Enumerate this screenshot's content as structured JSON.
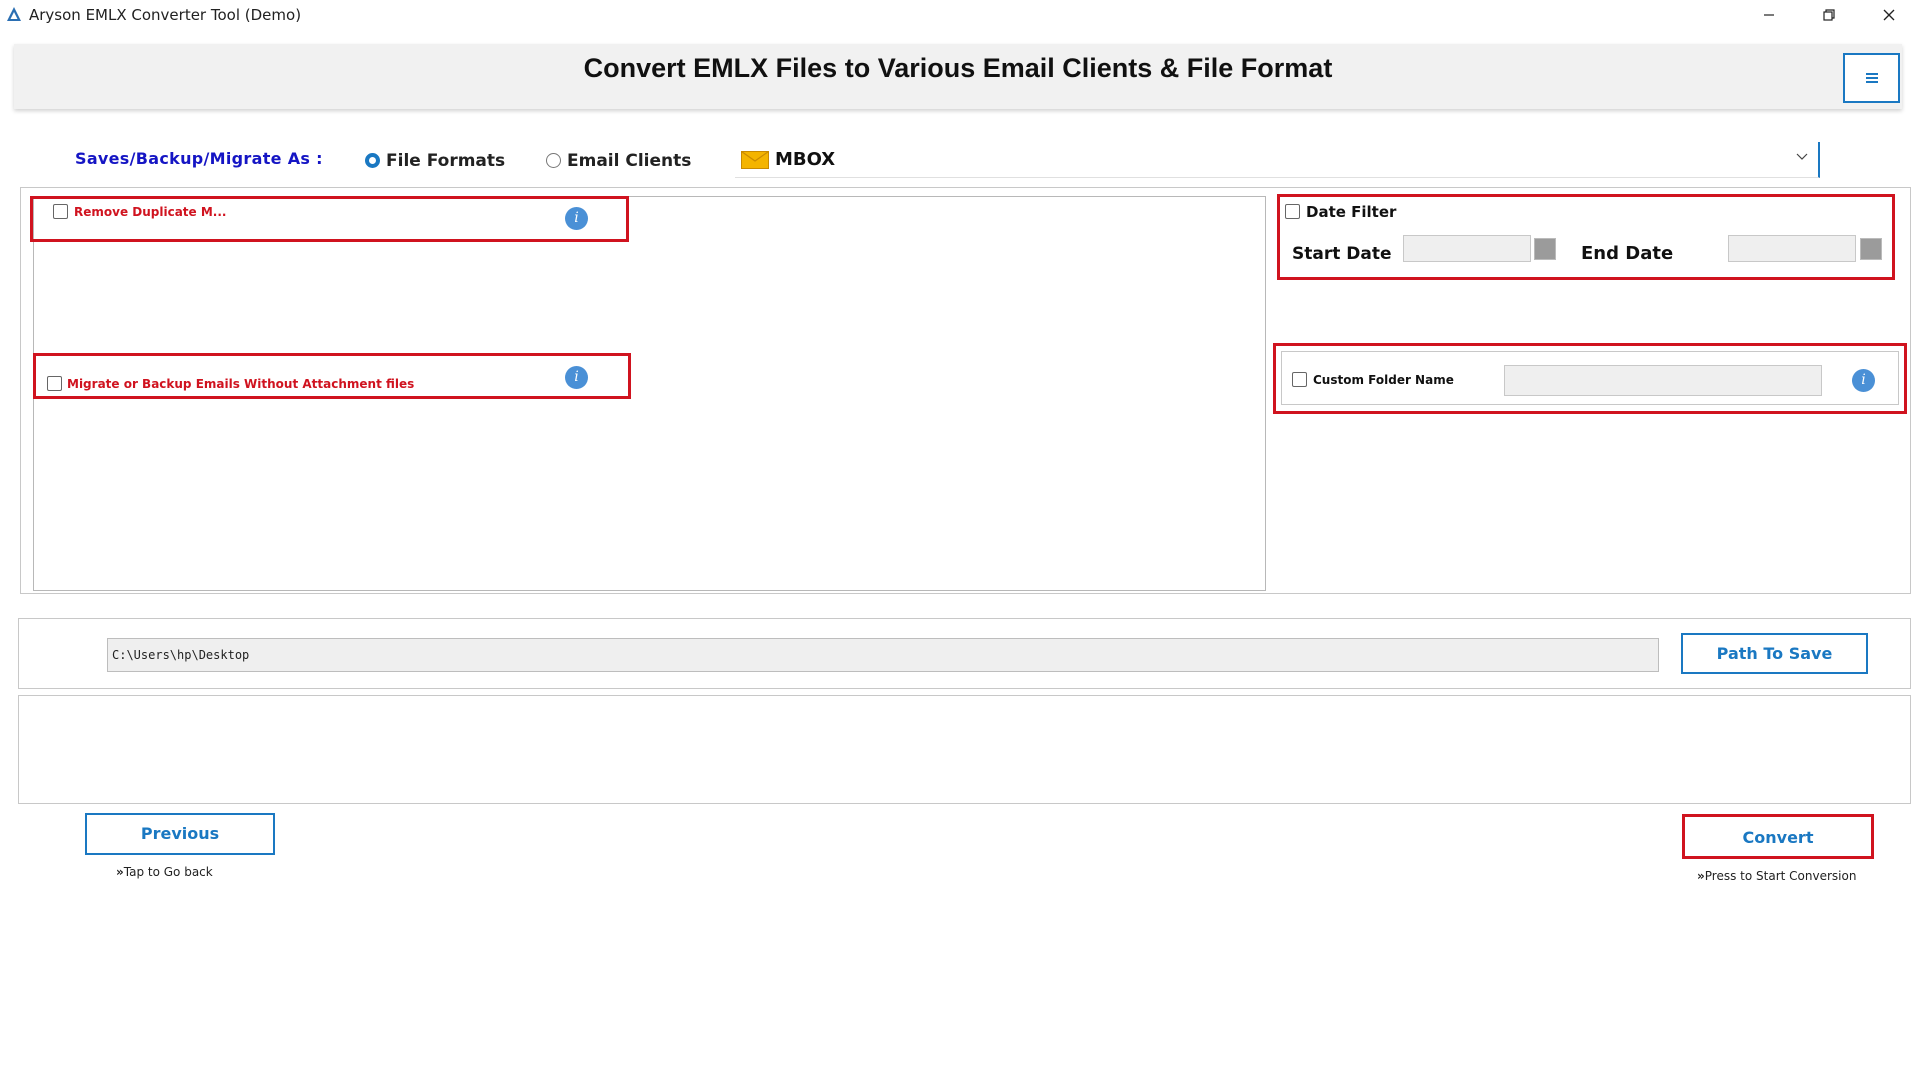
{
  "window": {
    "title": "Aryson EMLX Converter Tool (Demo)",
    "controls": {
      "minimize": "minimize-icon",
      "restore": "restore-icon",
      "close": "close-icon"
    }
  },
  "header": {
    "title": "Convert EMLX Files to Various Email Clients & File Format",
    "menu_icon": "hamburger-menu-icon"
  },
  "save_as": {
    "label": "Saves/Backup/Migrate As :",
    "options": [
      {
        "label": "File Formats",
        "selected": true
      },
      {
        "label": "Email Clients",
        "selected": false
      }
    ],
    "selected_format": "MBOX",
    "format_icon": "envelope-icon"
  },
  "options": {
    "remove_duplicate": {
      "label": "Remove Duplicate M...",
      "checked": false
    },
    "without_attachment": {
      "label": "Migrate or Backup Emails Without Attachment files",
      "checked": false
    },
    "date_filter": {
      "label": "Date Filter",
      "checked": false,
      "start_label": "Start Date",
      "end_label": "End Date",
      "start_value": "",
      "end_value": ""
    },
    "custom_folder": {
      "label": "Custom Folder Name",
      "checked": false,
      "value": ""
    }
  },
  "path": {
    "value": "C:\\Users\\hp\\Desktop",
    "button": "Path To Save"
  },
  "footer": {
    "previous_button": "Previous",
    "previous_hint": "Tap to Go back",
    "convert_button": "Convert",
    "convert_hint": "Press to Start Conversion",
    "hint_marker": "»",
    "accent_color": "#1a78c2",
    "highlight_color": "#d0131f"
  }
}
